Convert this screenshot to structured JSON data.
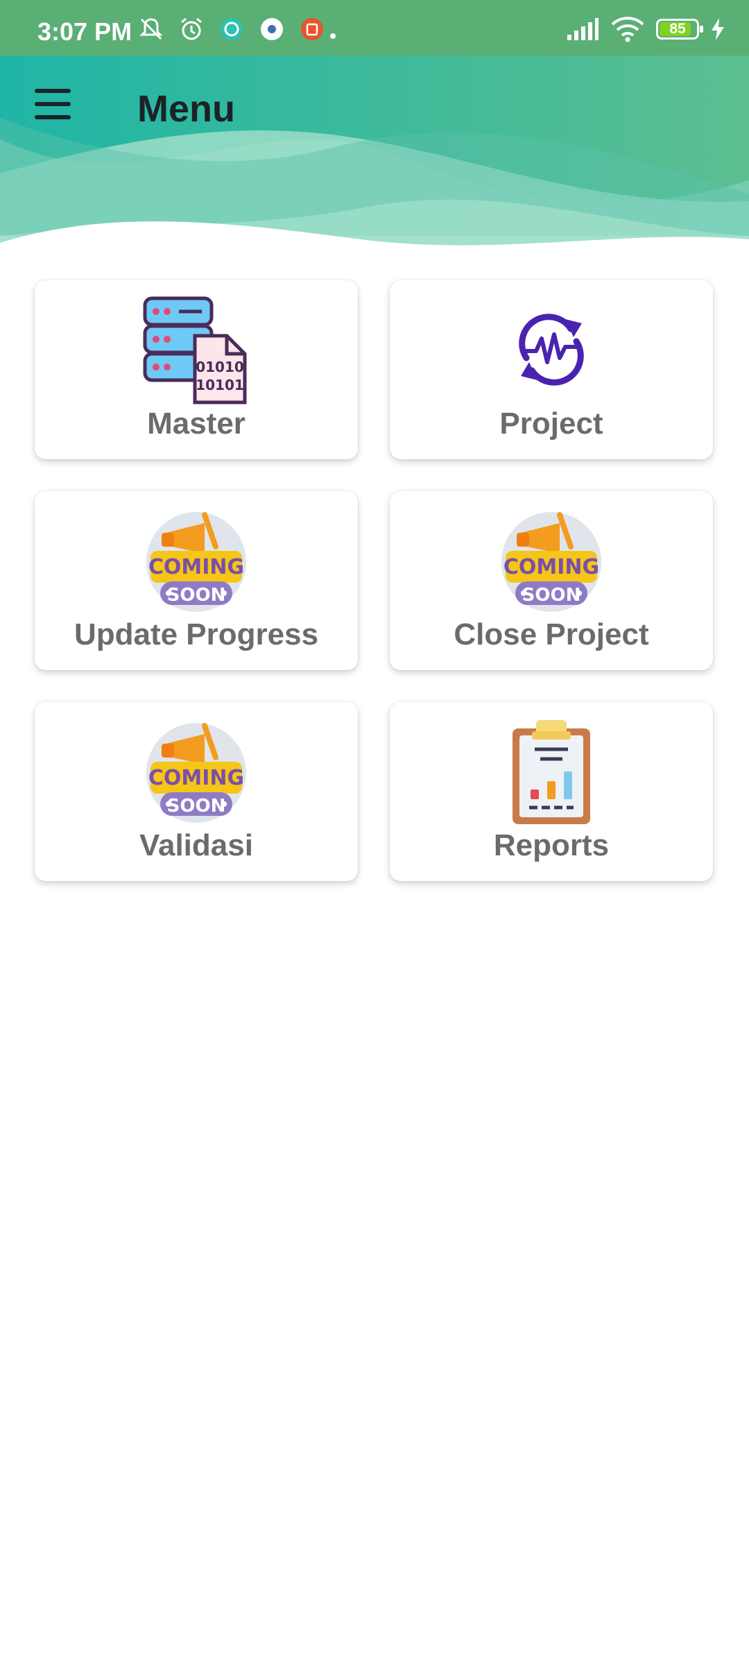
{
  "status_bar": {
    "time": "3:07 PM",
    "battery": "85",
    "icons": [
      "mute-icon",
      "alarm-icon",
      "whatsapp-icon",
      "settings-app-icon",
      "shop-app-icon",
      "signal-icon",
      "wifi-icon",
      "battery-icon",
      "charging-icon"
    ]
  },
  "header": {
    "title": "Menu",
    "gradient": [
      "#1fb5a6",
      "#5cc296",
      "#8fd8b2"
    ]
  },
  "menu_items": [
    {
      "label": "Master",
      "icon": "database-icon"
    },
    {
      "label": "Project",
      "icon": "project-activity-icon"
    },
    {
      "label": "Update Progress",
      "icon": "coming-soon-icon"
    },
    {
      "label": "Close Project",
      "icon": "coming-soon-icon"
    },
    {
      "label": "Validasi",
      "icon": "coming-soon-icon"
    },
    {
      "label": "Reports",
      "icon": "clipboard-report-icon"
    }
  ],
  "coming_soon": {
    "line1": "COMING",
    "line2": "SOON"
  }
}
